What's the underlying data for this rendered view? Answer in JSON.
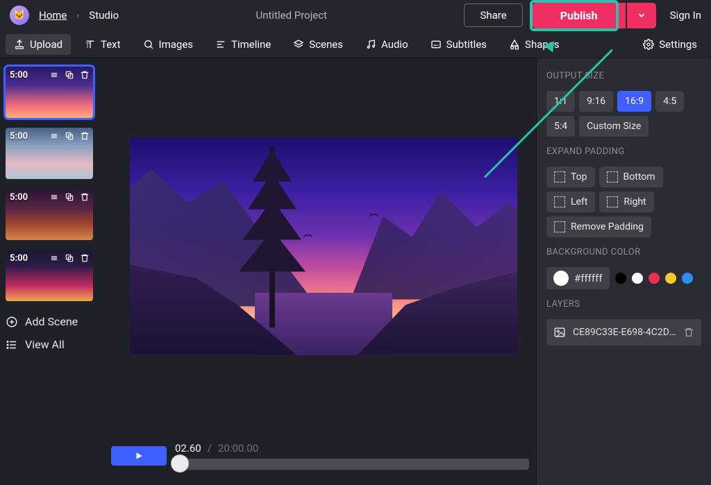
{
  "header": {
    "home": "Home",
    "studio": "Studio",
    "project_title": "Untitled Project",
    "share": "Share",
    "publish": "Publish",
    "signin": "Sign In"
  },
  "toolbar": {
    "upload": "Upload",
    "text": "Text",
    "images": "Images",
    "timeline": "Timeline",
    "scenes": "Scenes",
    "audio": "Audio",
    "subtitles": "Subtitles",
    "shapes": "Shapes",
    "settings": "Settings"
  },
  "scenes": {
    "items": [
      {
        "duration": "5:00"
      },
      {
        "duration": "5:00"
      },
      {
        "duration": "5:00"
      },
      {
        "duration": "5:00"
      }
    ],
    "add_scene": "Add Scene",
    "view_all": "View All"
  },
  "playback": {
    "current": "02.60",
    "separator": "/",
    "total": "20:00.00"
  },
  "sidebar": {
    "output_size_title": "OUTPUT SIZE",
    "ratios": [
      "1:1",
      "9:16",
      "16:9",
      "4:5",
      "5:4"
    ],
    "selected_ratio_index": 2,
    "custom_size": "Custom Size",
    "expand_padding_title": "EXPAND PADDING",
    "pad_top": "Top",
    "pad_bottom": "Bottom",
    "pad_left": "Left",
    "pad_right": "Right",
    "remove_padding": "Remove Padding",
    "bg_title": "BACKGROUND COLOR",
    "bg_value": "#ffffff",
    "preset_colors": [
      "#000000",
      "#ffffff",
      "#ef2e4f",
      "#f6c92a",
      "#2e8def"
    ],
    "layers_title": "LAYERS",
    "layers": [
      {
        "name": "CE89C33E-E698-4C2D-..."
      }
    ]
  }
}
